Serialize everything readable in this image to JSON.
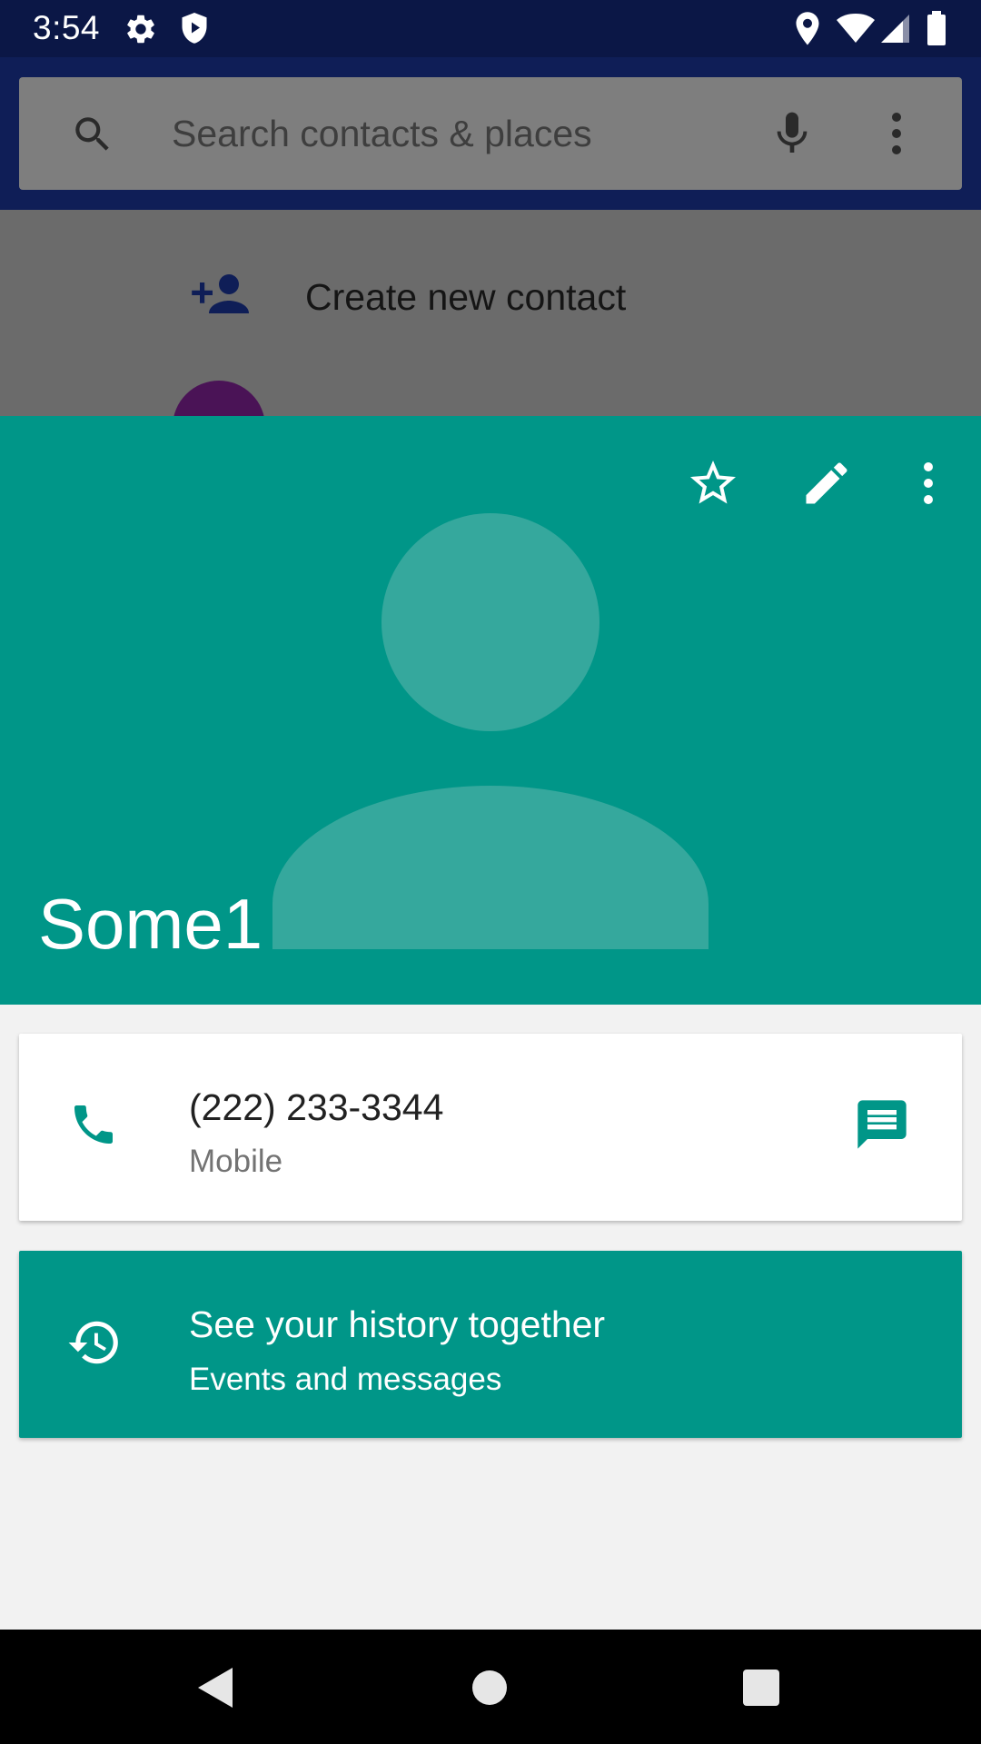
{
  "status_bar": {
    "time": "3:54",
    "icons": [
      "gear-icon",
      "shield-icon",
      "location-icon",
      "wifi-icon",
      "signal-icon",
      "battery-icon"
    ]
  },
  "search": {
    "placeholder": "Search contacts & places",
    "icons": [
      "search-icon",
      "mic-icon",
      "more-vert-icon"
    ]
  },
  "list": {
    "create_contact_label": "Create new contact"
  },
  "contact": {
    "name": "Some1",
    "header_actions": [
      "star-outline-icon",
      "edit-icon",
      "more-vert-icon"
    ],
    "phone": {
      "number": "(222) 233-3344",
      "type": "Mobile"
    },
    "history": {
      "title": "See your history together",
      "subtitle": "Events and messages"
    }
  },
  "colors": {
    "status_bar": "#0b1746",
    "header": "#009688",
    "avatar_placeholder": "#35a89d",
    "page_background": "#f2f2f2"
  },
  "nav_bar": {
    "icons": [
      "back-icon",
      "home-icon",
      "recents-icon"
    ]
  }
}
